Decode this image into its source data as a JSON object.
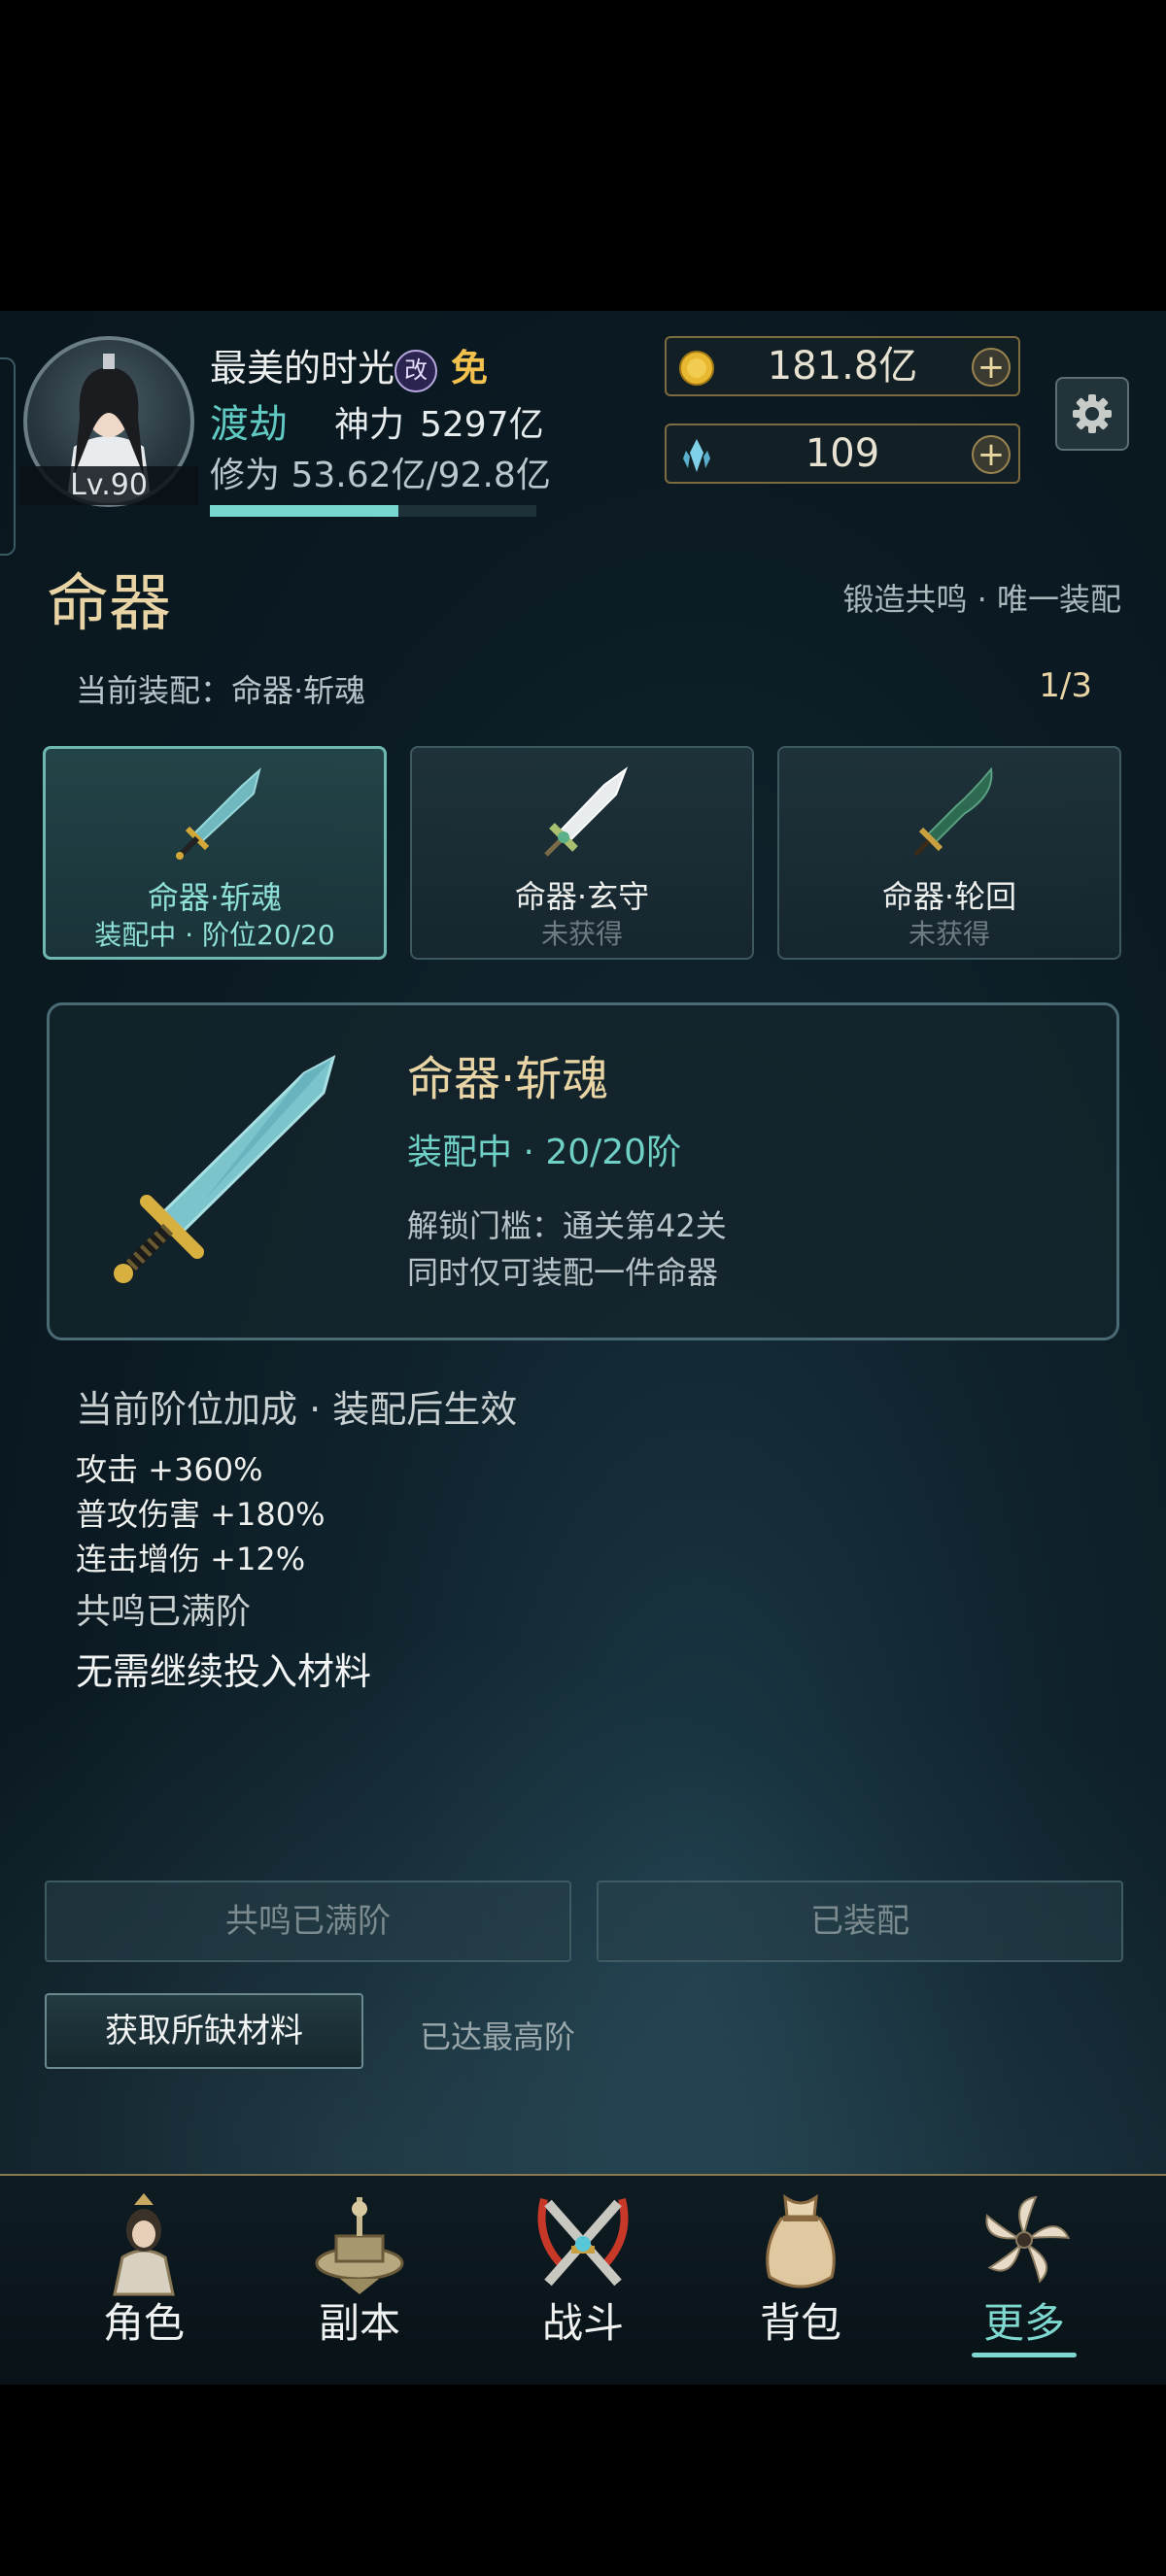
{
  "player": {
    "name": "最美的时光",
    "badge_gai": "改",
    "badge_mian": "免",
    "level": "Lv.90",
    "realm": "渡劫",
    "power_label": "神力",
    "power_value": "5297亿",
    "cultivation_label": "修为",
    "cultivation_value": "53.62亿/92.8亿",
    "cultivation_progress": 0.578
  },
  "resources": {
    "gold": "181.8亿",
    "crystal": "109",
    "plus": "+"
  },
  "page": {
    "title": "命器",
    "subtitle": "锻造共鸣 · 唯一装配",
    "current_equip": "当前装配：命器·斩魂",
    "count": "1/3"
  },
  "cards": [
    {
      "name": "命器·斩魂",
      "status": "装配中 · 阶位20/20",
      "active": true
    },
    {
      "name": "命器·玄守",
      "status": "未获得",
      "active": false
    },
    {
      "name": "命器·轮回",
      "status": "未获得",
      "active": false
    }
  ],
  "detail": {
    "name": "命器·斩魂",
    "status": "装配中 · 20/20阶",
    "unlock": "解锁门槛：通关第42关",
    "note": "同时仅可装配一件命器"
  },
  "bonus": {
    "title": "当前阶位加成 · 装配后生效",
    "stats": [
      "攻击 +360%",
      "普攻伤害 +180%",
      "连击增伤 +12%"
    ],
    "resonance": "共鸣已满阶",
    "no_need": "无需继续投入材料"
  },
  "buttons": {
    "resonance_full": "共鸣已满阶",
    "equipped": "已装配",
    "get_materials": "获取所缺材料",
    "max_tier": "已达最高阶"
  },
  "nav": [
    "角色",
    "副本",
    "战斗",
    "背包",
    "更多"
  ],
  "colors": {
    "accent": "#7fd8d0",
    "gold_text": "#e8d4a4",
    "background": "#0b1a22"
  }
}
